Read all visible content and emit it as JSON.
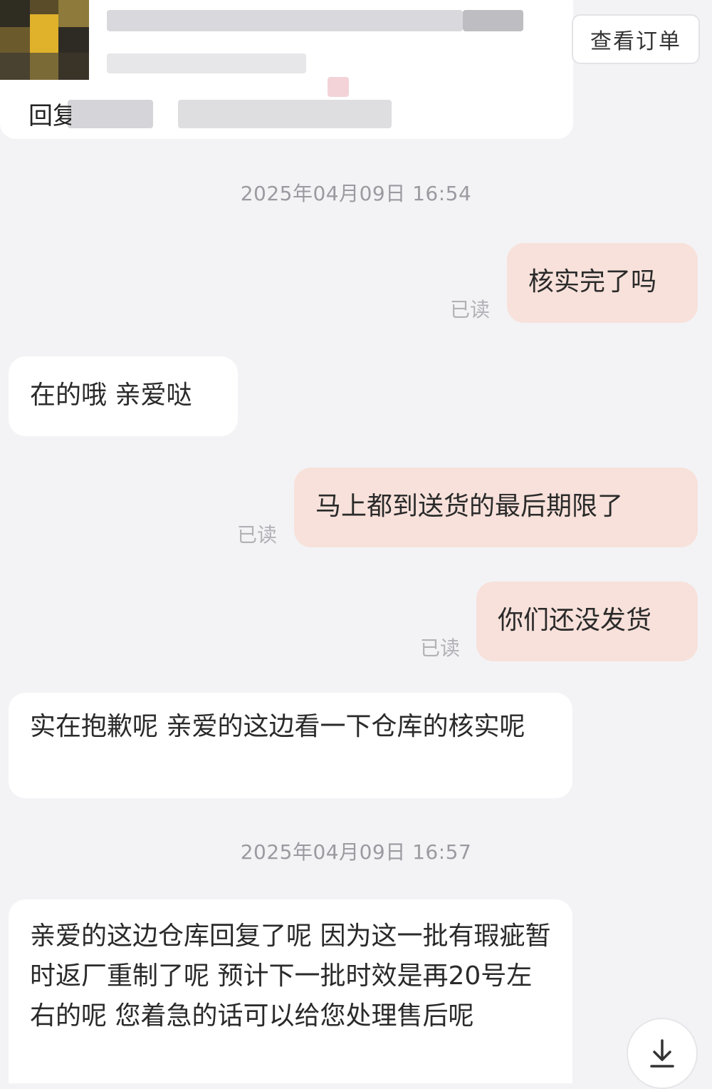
{
  "header": {
    "order_preview_label": "回复",
    "view_order_label": "查看订单"
  },
  "messages": [
    {
      "kind": "timestamp",
      "text": "2025年04月09日 16:54"
    },
    {
      "kind": "out",
      "text": "核实完了吗",
      "status": "已读"
    },
    {
      "kind": "in",
      "text": "在的哦 亲爱哒"
    },
    {
      "kind": "out",
      "text": "马上都到送货的最后期限了",
      "status": "已读"
    },
    {
      "kind": "out",
      "text": "你们还没发货",
      "status": "已读"
    },
    {
      "kind": "in",
      "text": "实在抱歉呢 亲爱的这边看一下仓库的核实呢"
    },
    {
      "kind": "timestamp",
      "text": "2025年04月09日 16:57"
    },
    {
      "kind": "in",
      "text": "亲爱的这边仓库回复了呢 因为这一批有瑕疵暂时返厂重制了呢 预计下一批时效是再20号左右的呢 您着急的话可以给您处理售后呢"
    }
  ],
  "icons": {
    "scroll_down": "arrow-down-to-line-icon"
  }
}
